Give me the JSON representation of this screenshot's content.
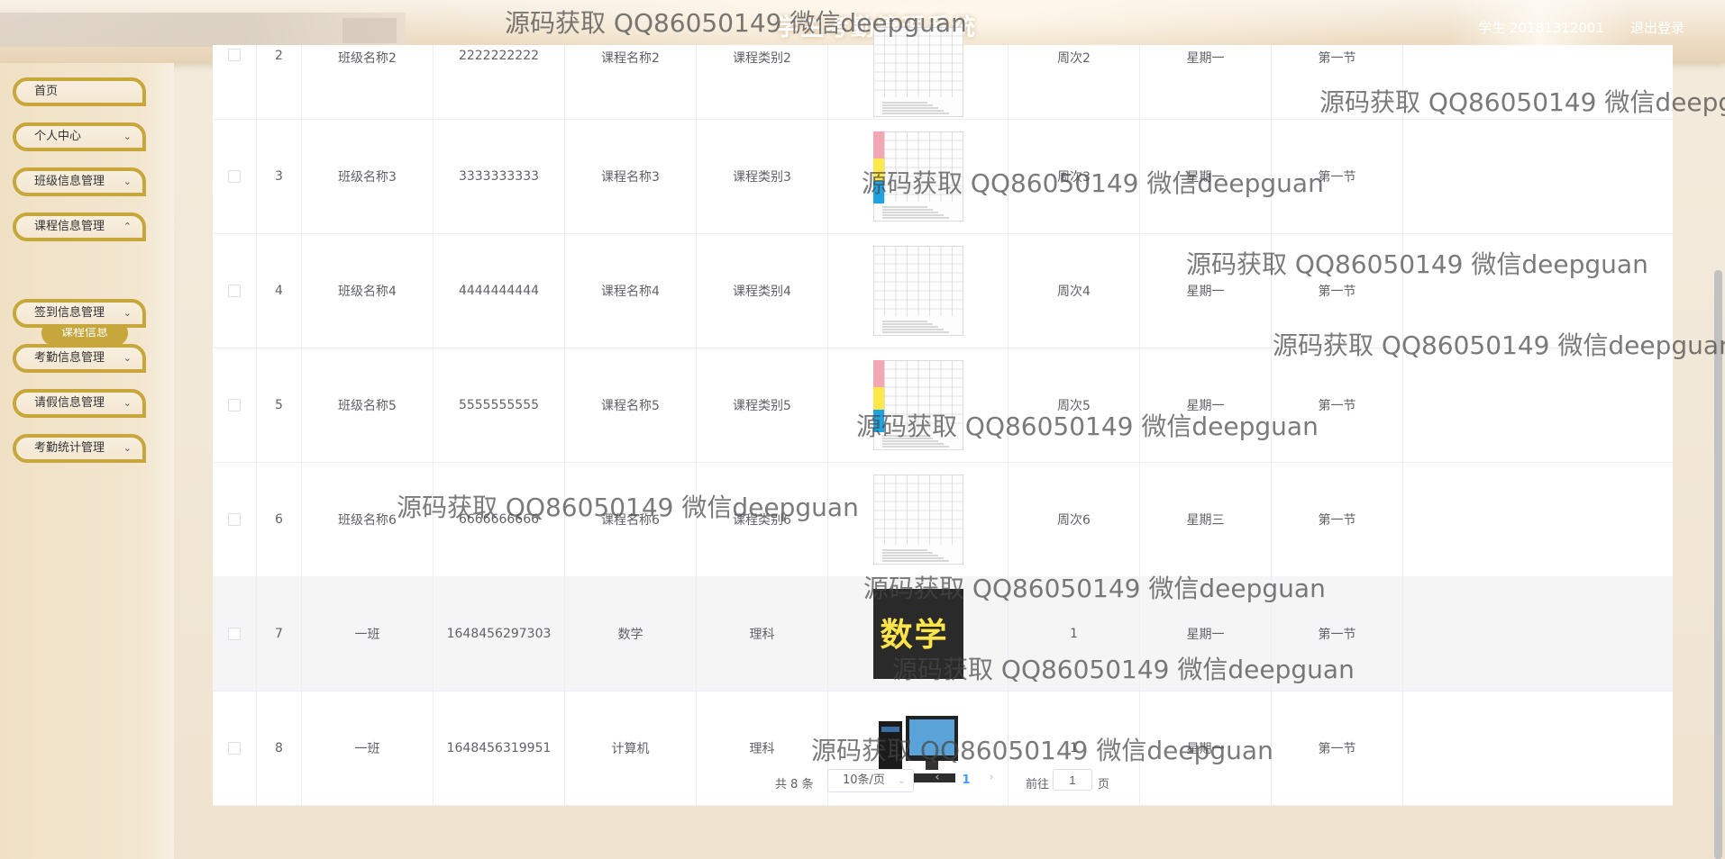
{
  "header": {
    "system_title": "学生考勤管理系统",
    "user_label": "学生 20181312001",
    "logout_label": "退出登录"
  },
  "sidebar": {
    "items": [
      {
        "label": "首页",
        "expandable": false
      },
      {
        "label": "个人中心",
        "expandable": true
      },
      {
        "label": "班级信息管理",
        "expandable": true
      },
      {
        "label": "课程信息管理",
        "expandable": true
      },
      {
        "label": "签到信息管理",
        "expandable": true
      },
      {
        "label": "考勤信息管理",
        "expandable": true
      },
      {
        "label": "请假信息管理",
        "expandable": true
      },
      {
        "label": "考勤统计管理",
        "expandable": true
      }
    ],
    "active_subitem": "课程信息"
  },
  "table": {
    "rows": [
      {
        "index": "2",
        "class_name": "班级名称2",
        "course_no": "2222222222",
        "course_name": "课程名称2",
        "course_type": "课程类别2",
        "image": "schedule-grid",
        "week": "周次2",
        "weekday": "星期一",
        "period": "第一节"
      },
      {
        "index": "3",
        "class_name": "班级名称3",
        "course_no": "3333333333",
        "course_name": "课程名称3",
        "course_type": "课程类别3",
        "image": "schedule-colored",
        "week": "周次3",
        "weekday": "星期一",
        "period": "第一节"
      },
      {
        "index": "4",
        "class_name": "班级名称4",
        "course_no": "4444444444",
        "course_name": "课程名称4",
        "course_type": "课程类别4",
        "image": "schedule-grid",
        "week": "周次4",
        "weekday": "星期一",
        "period": "第一节"
      },
      {
        "index": "5",
        "class_name": "班级名称5",
        "course_no": "5555555555",
        "course_name": "课程名称5",
        "course_type": "课程类别5",
        "image": "schedule-colored",
        "week": "周次5",
        "weekday": "星期一",
        "period": "第一节"
      },
      {
        "index": "6",
        "class_name": "班级名称6",
        "course_no": "6666666666",
        "course_name": "课程名称6",
        "course_type": "课程类别6",
        "image": "schedule-grid",
        "week": "周次6",
        "weekday": "星期三",
        "period": "第一节"
      },
      {
        "index": "7",
        "class_name": "一班",
        "course_no": "1648456297303",
        "course_name": "数学",
        "course_type": "理科",
        "image": "math-chalkboard",
        "week": "1",
        "weekday": "星期一",
        "period": "第一节"
      },
      {
        "index": "8",
        "class_name": "一班",
        "course_no": "1648456319951",
        "course_name": "计算机",
        "course_type": "理科",
        "image": "computer",
        "week": "1",
        "weekday": "星期一",
        "period": "第一节"
      }
    ],
    "math_image_text": "数学"
  },
  "pagination": {
    "total_text": "共 8 条",
    "page_size": "10条/页",
    "current_page": "1",
    "goto_label": "前往",
    "goto_value": "1",
    "page_unit": "页"
  },
  "watermark": "源码获取 QQ86050149 微信deepguan"
}
